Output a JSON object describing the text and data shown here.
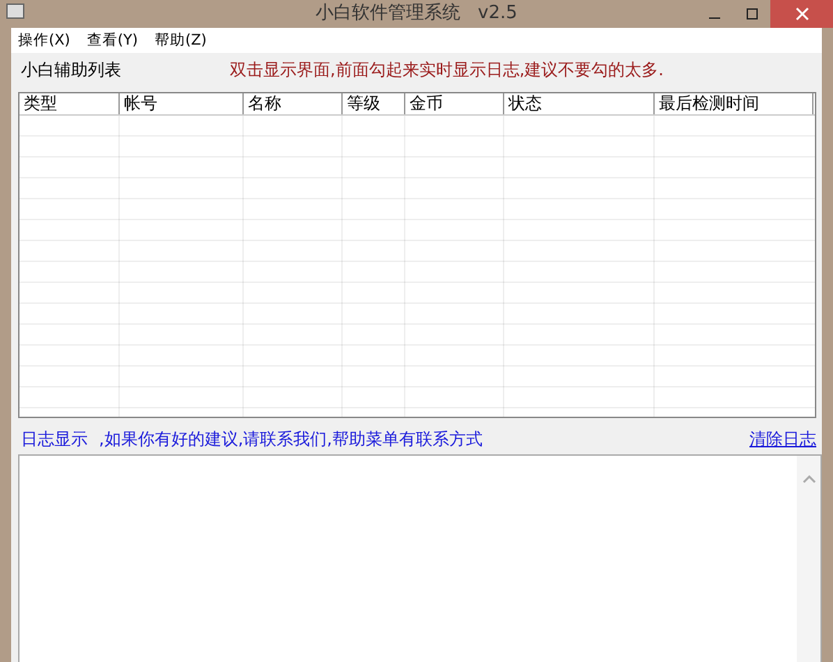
{
  "window": {
    "title": "小白软件管理系统   v2.5"
  },
  "menu": [
    {
      "label": "操作(X)"
    },
    {
      "label": "查看(Y)"
    },
    {
      "label": "帮助(Z)"
    }
  ],
  "list_label": "小白辅助列表",
  "list_hint": "双击显示界面,前面勾起来实时显示日志,建议不要勾的太多.",
  "table": {
    "columns": [
      "类型",
      "帐号",
      "名称",
      "等级",
      "金币",
      "状态",
      "最后检测时间"
    ]
  },
  "log_label": "日志显示",
  "log_hint": ",如果你有好的建议,请联系我们,帮助菜单有联系方式",
  "clear_log_link": "清除日志"
}
